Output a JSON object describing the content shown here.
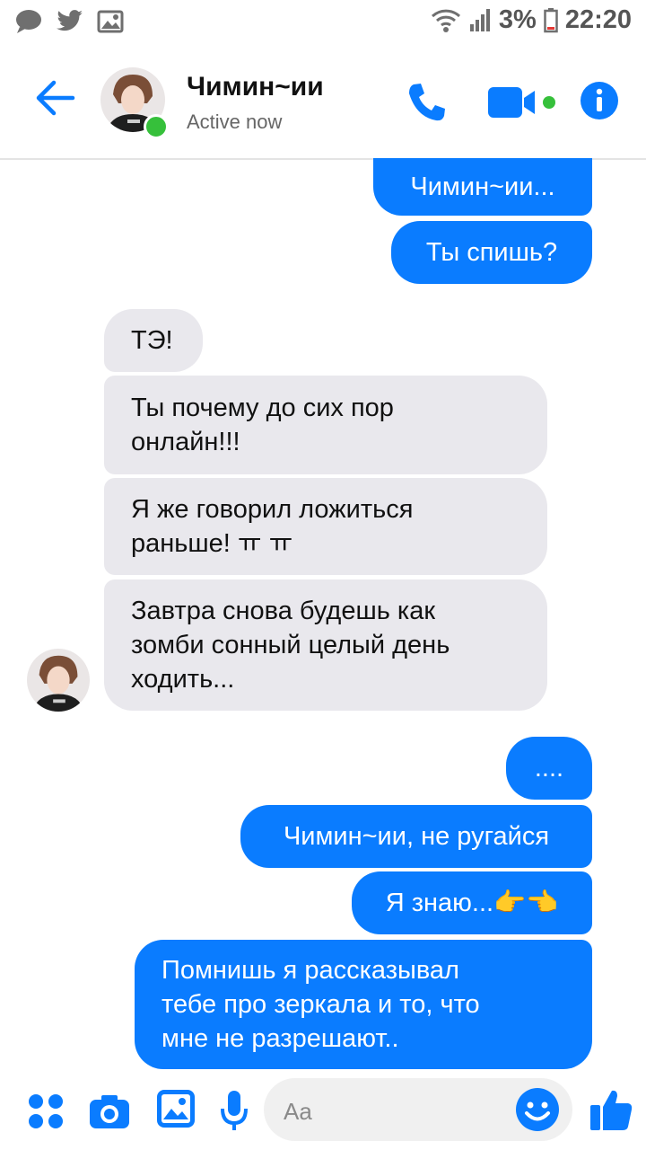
{
  "status_bar": {
    "battery": "3%",
    "time": "22:20"
  },
  "header": {
    "contact_name": "Чимин~ии",
    "status": "Active now"
  },
  "messages": [
    {
      "from": "me",
      "text": "Чимин~ии..."
    },
    {
      "from": "me",
      "text": "Ты спишь?"
    },
    {
      "from": "contact",
      "text": "ТЭ!"
    },
    {
      "from": "contact",
      "lines": [
        "Ты почему до сих пор",
        "онлайн!!!"
      ]
    },
    {
      "from": "contact",
      "lines": [
        "Я же говорил ложиться",
        "раньше! ㅠ ㅠ"
      ]
    },
    {
      "from": "contact",
      "lines": [
        "Завтра снова будешь как",
        "зомби сонный целый день",
        "ходить..."
      ]
    },
    {
      "from": "me",
      "text": "...."
    },
    {
      "from": "me",
      "text": "Чимин~ии, не ругайся"
    },
    {
      "from": "me",
      "text": "Я знаю...👉👈"
    },
    {
      "from": "me",
      "lines": [
        "Помнишь я рассказывал",
        "тебе про  зеркала и то, что",
        "мне не разрешают.."
      ]
    }
  ],
  "composer": {
    "placeholder": "Aa"
  },
  "icons": {
    "status_left": [
      "chat-bubble-icon",
      "twitter-icon",
      "image-icon"
    ],
    "status_right": [
      "wifi-icon",
      "signal-icon",
      "battery-icon"
    ],
    "header": [
      "back-arrow-icon",
      "phone-icon",
      "video-icon",
      "info-icon"
    ],
    "composer": [
      "apps-icon",
      "camera-icon",
      "gallery-icon",
      "microphone-icon",
      "emoji-icon",
      "thumbs-up-icon"
    ]
  },
  "colors": {
    "accent": "#0a7cff",
    "received_bubble": "#e9e8ed",
    "online": "#36c03b"
  }
}
